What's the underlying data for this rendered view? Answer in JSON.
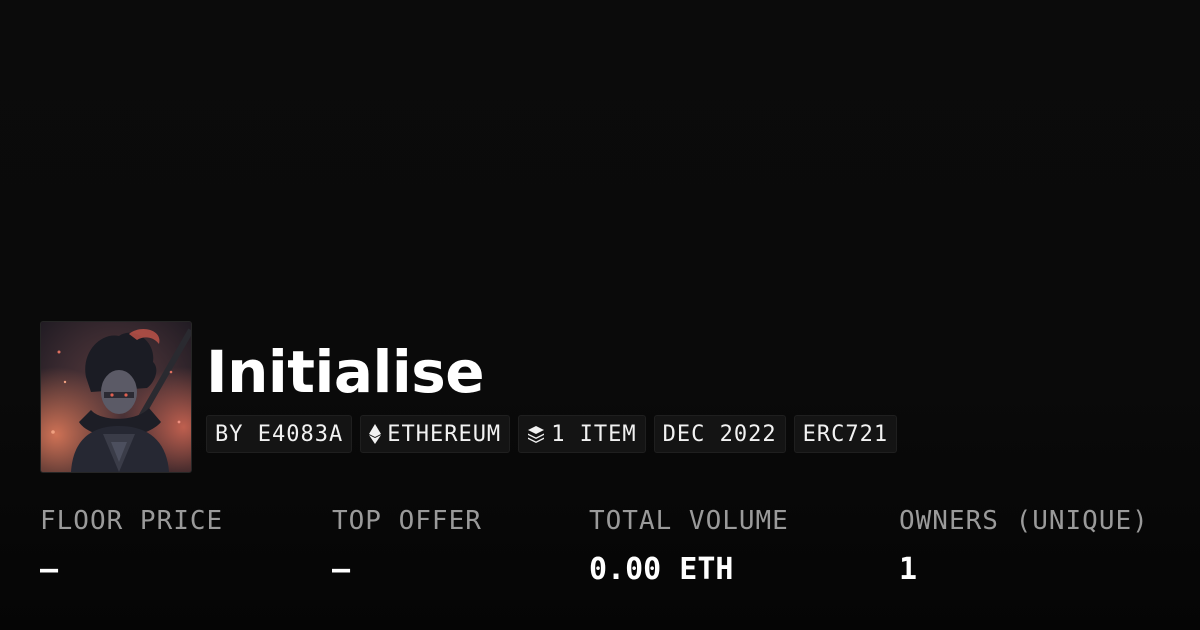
{
  "collection": {
    "name": "Initialise",
    "avatar_icon": "collection-avatar-image"
  },
  "tags": [
    {
      "label": "BY E4083A",
      "icon": ""
    },
    {
      "label": "ETHEREUM",
      "icon": "ethereum-icon"
    },
    {
      "label": "1 ITEM",
      "icon": "layers-icon"
    },
    {
      "label": "DEC 2022",
      "icon": ""
    },
    {
      "label": "ERC721",
      "icon": ""
    }
  ],
  "stats": [
    {
      "label": "FLOOR PRICE",
      "value": "—"
    },
    {
      "label": "TOP OFFER",
      "value": "—"
    },
    {
      "label": "TOTAL VOLUME",
      "value": "0.00 ETH"
    },
    {
      "label": "OWNERS (UNIQUE)",
      "value": "1"
    }
  ],
  "colors": {
    "background": "#0a0a0a",
    "tag_background": "#141414",
    "label_gray": "#9a9a9a",
    "text": "#ffffff"
  }
}
